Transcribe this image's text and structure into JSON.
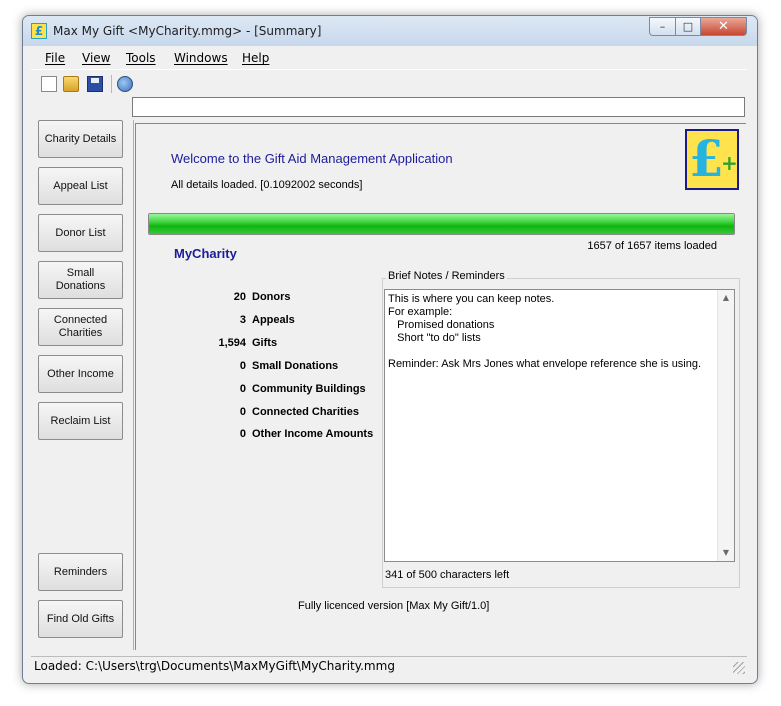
{
  "window": {
    "title": "Max My Gift <MyCharity.mmg>  - [Summary]",
    "controls": {
      "minimize": "–",
      "maximize": "□",
      "close": "✕"
    }
  },
  "menu": {
    "items": [
      {
        "label": "File"
      },
      {
        "label": "View"
      },
      {
        "label": "Tools"
      },
      {
        "label": "Windows"
      },
      {
        "label": "Help"
      }
    ]
  },
  "toolbar": {
    "icons": [
      "new-file-icon",
      "open-folder-icon",
      "save-icon",
      "help-icon"
    ]
  },
  "sidebar": {
    "buttons": [
      {
        "label": "Charity Details"
      },
      {
        "label": "Appeal List"
      },
      {
        "label": "Donor List"
      },
      {
        "label": "Small Donations"
      },
      {
        "label": "Connected Charities"
      },
      {
        "label": "Other Income"
      },
      {
        "label": "Reclaim List"
      },
      {
        "label": "Reminders"
      },
      {
        "label": "Find Old Gifts"
      }
    ]
  },
  "summary": {
    "welcome_title": "Welcome to the Gift Aid Management Application",
    "details_loaded": "All details loaded. [0.1092002 seconds]",
    "logo_text": "£",
    "logo_plus": "+",
    "progress_fraction": 1.0,
    "items_loaded": "1657 of 1657 items loaded",
    "charity_name": "MyCharity",
    "stats": [
      {
        "value": "20",
        "label": "Donors"
      },
      {
        "value": "3",
        "label": "Appeals"
      },
      {
        "value": "1,594",
        "label": "Gifts"
      },
      {
        "value": "0",
        "label": "Small Donations"
      },
      {
        "value": "0",
        "label": "Community Buildings"
      },
      {
        "value": "0",
        "label": "Connected Charities"
      },
      {
        "value": "0",
        "label": "Other Income Amounts"
      }
    ],
    "notes": {
      "legend": "Brief Notes / Reminders",
      "text": "This is where you can keep notes.\nFor example:\n   Promised donations\n   Short \"to do\" lists\n\nReminder: Ask Mrs Jones what envelope reference she is using.",
      "char_count": "341 of 500 characters left"
    },
    "licence": "Fully licenced version [Max My Gift/1.0]"
  },
  "status_bar": {
    "text": "Loaded: C:\\Users\\trg\\Documents\\MaxMyGift\\MyCharity.mmg"
  },
  "colors": {
    "heading_blue": "#1c1c9a",
    "progress_green": "#10b510",
    "logo_yellow": "#ffe34d"
  }
}
